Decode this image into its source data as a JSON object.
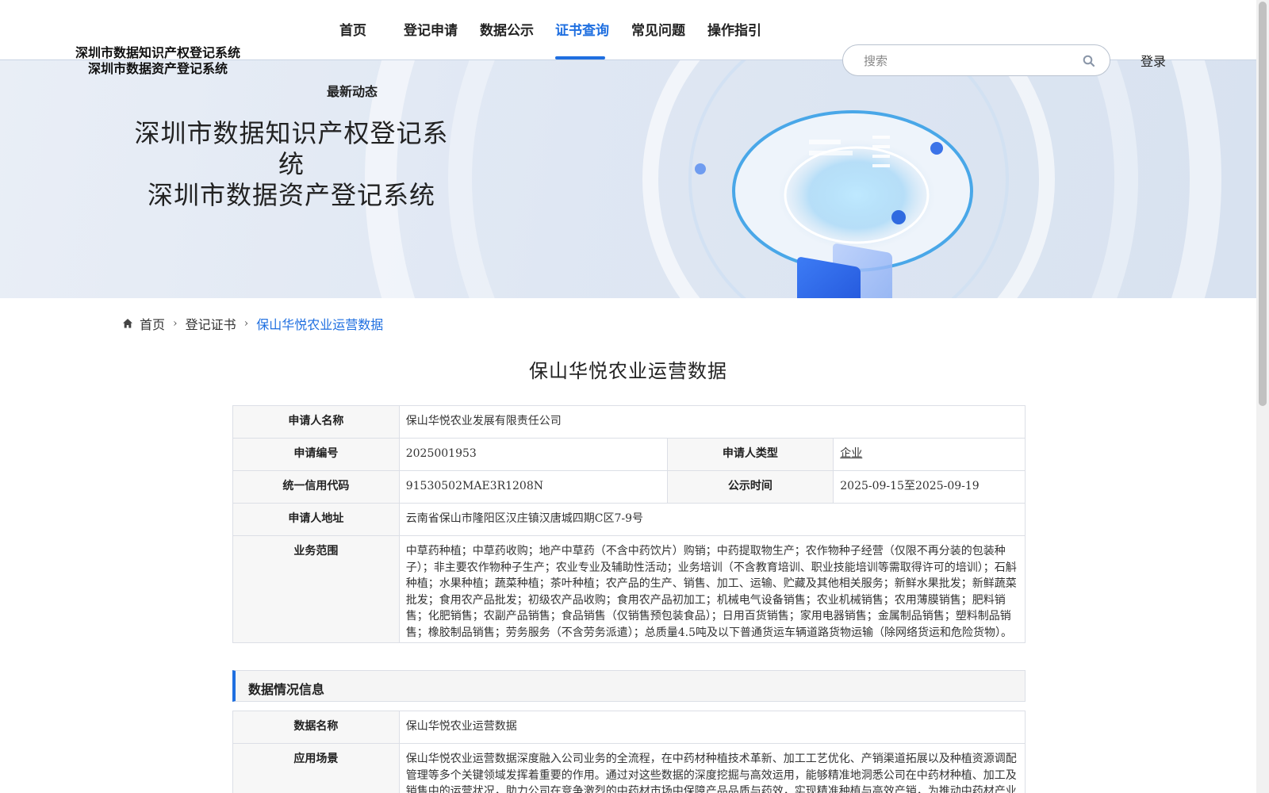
{
  "header": {
    "logo_line1": "深圳市数据知识产权登记系统",
    "logo_line2": "深圳市数据资产登记系统",
    "nav": [
      "首页",
      "登记申请",
      "数据公示",
      "证书查询",
      "常见问题",
      "操作指引"
    ],
    "nav_second": "最新动态",
    "active_nav": "证书查询",
    "search_placeholder": "搜索",
    "login": "登录"
  },
  "banner": {
    "title_line1": "深圳市数据知识产权登记系统",
    "title_line2": "深圳市数据资产登记系统"
  },
  "breadcrumb": {
    "home": "首页",
    "level2": "登记证书",
    "current": "保山华悦农业运营数据"
  },
  "page_title": "保山华悦农业运营数据",
  "applicant": {
    "name_label": "申请人名称",
    "name": "保山华悦农业发展有限责任公司",
    "no_label": "申请编号",
    "no": "2025001953",
    "type_label": "申请人类型",
    "type": "企业",
    "credit_label": "统一信用代码",
    "credit": "91530502MAE3R1208N",
    "pub_label": "公示时间",
    "pub": "2025-09-15至2025-09-19",
    "addr_label": "申请人地址",
    "addr": "云南省保山市隆阳区汉庄镇汉唐城四期C区7-9号",
    "scope_label": "业务范围",
    "scope": "中草药种植；中草药收购；地产中草药（不含中药饮片）购销；中药提取物生产；农作物种子经营（仅限不再分装的包装种子）；非主要农作物种子生产；农业专业及辅助性活动；业务培训（不含教育培训、职业技能培训等需取得许可的培训）；石斛种植；水果种植；蔬菜种植；茶叶种植；农产品的生产、销售、加工、运输、贮藏及其他相关服务；新鲜水果批发；新鲜蔬菜批发；食用农产品批发；初级农产品收购；食用农产品初加工；机械电气设备销售；农业机械销售；农用薄膜销售；肥料销售；化肥销售；农副产品销售；食品销售（仅销售预包装食品）；日用百货销售；家用电器销售；金属制品销售；塑料制品销售；橡胶制品销售；劳务服务（不含劳务派遣）；总质量4.5吨及以下普通货运车辆道路货物运输（除网络货运和危险货物）。"
  },
  "data_section": {
    "heading": "数据情况信息",
    "name_label": "数据名称",
    "name": "保山华悦农业运营数据",
    "scene_label": "应用场景",
    "scene": "保山华悦农业运营数据深度融入公司业务的全流程，在中药材种植技术革新、加工工艺优化、产销渠道拓展以及种植资源调配管理等多个关键领域发挥着重要的作用。通过对这些数据的深度挖掘与高效运用，能够精准地洞悉公司在中药材种植、加工及销售中的运营状况，助力公司在竞争激烈的中药材市场中保障产品品质与药效，实现精准种植与高效产销，为推动中药材产业"
  },
  "colors": {
    "accent": "#1f6fe0",
    "label_bg": "#f7f7f7",
    "border": "#dcdfe6"
  }
}
